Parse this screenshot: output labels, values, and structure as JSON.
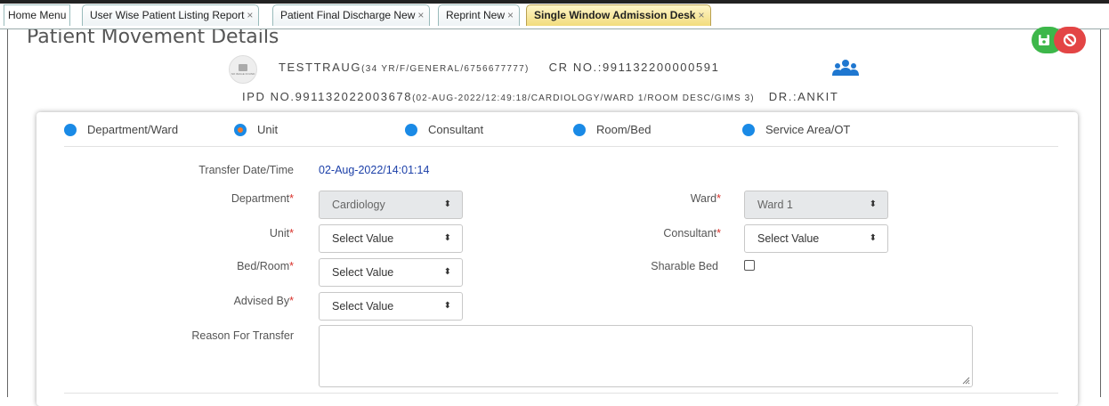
{
  "tabs": {
    "home": "Home Menu",
    "items": [
      {
        "label": "User Wise Patient Listing Report",
        "close": "×"
      },
      {
        "label": "Patient Final Discharge New",
        "close": "×"
      },
      {
        "label": "Reprint New",
        "close": "×"
      },
      {
        "label": "Single Window Admission Desk",
        "close": "×"
      }
    ]
  },
  "page": {
    "title": "Patient Movement Details"
  },
  "patient": {
    "name": "TESTTRAUG",
    "details": "(34 YR/F/GENERAL/6756677777)",
    "cr": "CR NO.:991132200000591",
    "ipd": "IPD NO.991132022003678",
    "ipd_details": "(02-AUG-2022/12:49:18/CARDIOLOGY/WARD 1/ROOM DESC/GIMS 3)",
    "doctor": "DR.:ANKIT",
    "photo_text": "NO IMAGE FOUND"
  },
  "transfer_types": [
    {
      "label": "Department/Ward",
      "selected": false
    },
    {
      "label": "Unit",
      "selected": true
    },
    {
      "label": "Consultant",
      "selected": false
    },
    {
      "label": "Room/Bed",
      "selected": false
    },
    {
      "label": "Service Area/OT",
      "selected": false
    }
  ],
  "form": {
    "transfer_datetime_label": "Transfer Date/Time",
    "transfer_datetime_value": "02-Aug-2022/14:01:14",
    "department_label": "Department",
    "department_value": "Cardiology",
    "ward_label": "Ward",
    "ward_value": "Ward 1",
    "unit_label": "Unit",
    "unit_value": "Select Value",
    "consultant_label": "Consultant",
    "consultant_value": "Select Value",
    "bedroom_label": "Bed/Room",
    "bedroom_value": "Select Value",
    "sharable_label": "Sharable Bed",
    "sharable_checked": false,
    "advised_label": "Advised By",
    "advised_value": "Select Value",
    "reason_label": "Reason For Transfer",
    "reason_value": "",
    "required_mark": "*",
    "select_arrow": "⬍"
  },
  "colors": {
    "radio": "#1a8ae6",
    "radio_selected_inner": "#f47a2a",
    "save_button": "#3db74a",
    "cancel_button": "#e34545",
    "required": "#d9312b",
    "date_value": "#1b3fa8"
  },
  "icons": {
    "save": "floppy-disk-icon",
    "cancel": "ban-icon",
    "users": "users-icon",
    "select": "sort-arrows-icon"
  }
}
